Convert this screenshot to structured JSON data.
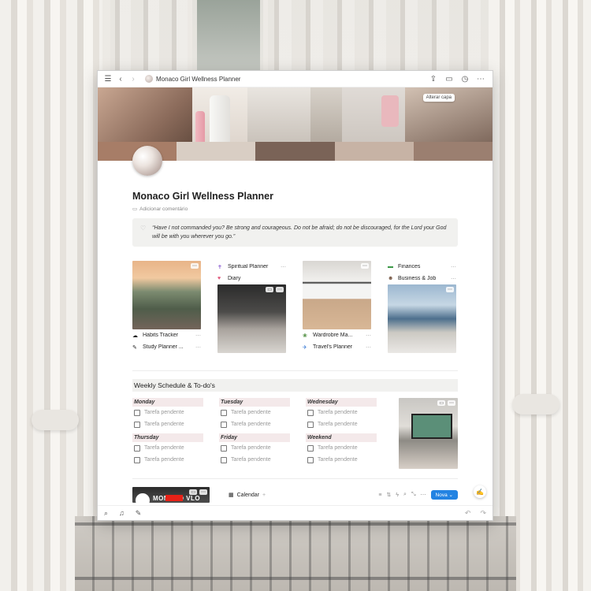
{
  "topbar": {
    "breadcrumb_title": "Monaco Girl Wellness Planner",
    "icons": [
      "menu-icon",
      "back-icon",
      "forward-icon",
      "share-icon",
      "comment-icon",
      "clock-icon",
      "more-icon"
    ]
  },
  "cover": {
    "change_cover_label": "Alterar capa"
  },
  "page": {
    "title": "Monaco Girl Wellness Planner",
    "add_comment": "Adicionar comentário",
    "quote": "“Have I not commanded you? Be strong and courageous. Do not be afraid; do not be discouraged, for the Lord your God will be with you wherever you go.”"
  },
  "gallery": [
    {
      "items": [
        {
          "label": "Habits Tracker"
        },
        {
          "label": "Study Planner ..."
        }
      ]
    },
    {
      "items": [
        {
          "label": "Spiritual Planner"
        },
        {
          "label": "Diary"
        }
      ]
    },
    {
      "items": [
        {
          "label": "Wardrobre Ma..."
        },
        {
          "label": "Travel's Planner"
        }
      ]
    },
    {
      "items": [
        {
          "label": "Finances"
        },
        {
          "label": "Business & Job"
        }
      ]
    }
  ],
  "weekly": {
    "heading": "Weekly Schedule & To-do's",
    "task_placeholder": "Tarefa pendente",
    "days": [
      "Monday",
      "Tuesday",
      "Wednesday",
      "Thursday",
      "Friday",
      "Weekend"
    ]
  },
  "bottom": {
    "yt_text": "MONACO VLO",
    "calendar_tab": "Calendar",
    "new_button": "Nova"
  },
  "colors": {
    "accent": "#2383e2",
    "day_header_bg": "#f4e9ea"
  }
}
